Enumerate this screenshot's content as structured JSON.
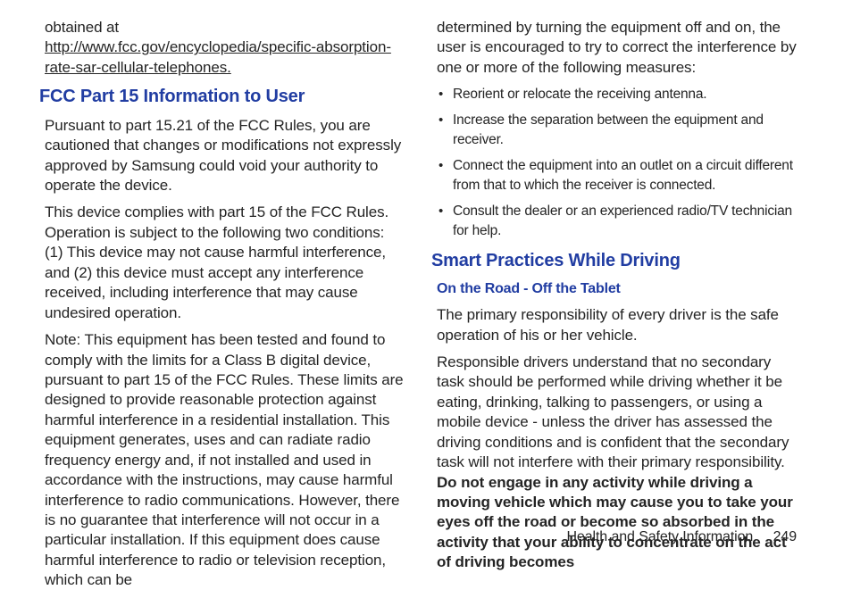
{
  "left": {
    "obtained_at": "obtained at",
    "url": "http://www.fcc.gov/encyclopedia/specific-absorption-rate-sar-cellular-telephones.",
    "h2": "FCC Part 15 Information to User",
    "p1": "Pursuant to part 15.21 of the FCC Rules, you are cautioned that changes or modifications not expressly approved by Samsung could void your authority to operate the device.",
    "p2": "This device complies with part 15 of the FCC Rules. Operation is subject to the following two conditions: (1) This device may not cause harmful interference, and (2) this device must accept any interference received, including interference that may cause undesired operation.",
    "p3": "Note: This equipment has been tested and found to comply with the limits for a Class B digital device, pursuant to part 15 of the FCC Rules. These limits are designed to provide reasonable protection against harmful interference in a residential installation. This equipment generates, uses and can radiate radio frequency energy and, if not installed and used in accordance with the instructions, may cause harmful interference to radio communications. However, there is no guarantee that interference will not occur in a particular installation. If this equipment does cause harmful interference to radio or television reception, which can be"
  },
  "right": {
    "p1": "determined by turning the equipment off and on, the user is encouraged to try to correct the interference by one or more of the following measures:",
    "bullets": [
      "Reorient or relocate the receiving antenna.",
      "Increase the separation between the equipment and receiver.",
      "Connect the equipment into an outlet on a circuit different from that to which the receiver is connected.",
      "Consult the dealer or an experienced radio/TV technician for help."
    ],
    "h2": "Smart Practices While Driving",
    "h3": "On the Road - Off the Tablet",
    "p2": "The primary responsibility of every driver is the safe operation of his or her vehicle.",
    "p3_a": "Responsible drivers understand that no secondary task should be performed while driving whether it be eating, drinking, talking to passengers, or using a mobile device - unless the driver has assessed the driving conditions and is confident that the secondary task will not interfere with their primary responsibility. ",
    "p3_b": "Do not engage in any activity while driving a moving vehicle which may cause you to take your eyes off the road or become so absorbed in the activity that your ability to concentrate on the act of driving becomes"
  },
  "footer": {
    "section": "Health and Safety Information",
    "page": "249"
  }
}
